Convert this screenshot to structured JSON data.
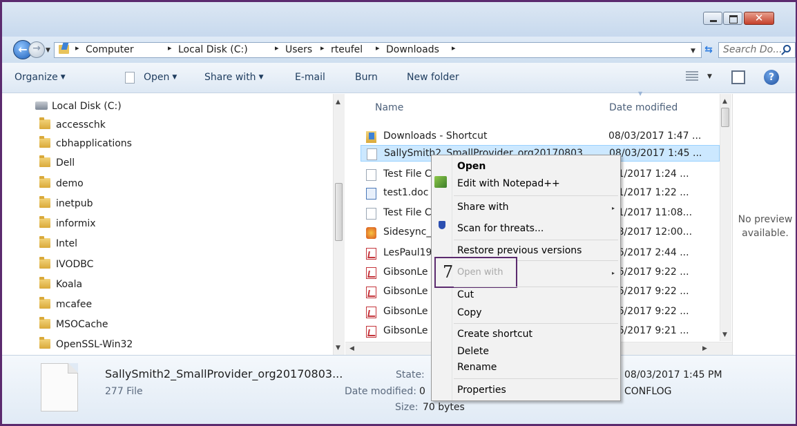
{
  "titlebar": {
    "close_glyph": "✕"
  },
  "address": {
    "crumbs": [
      "Computer",
      "Local Disk (C:)",
      "Users",
      "rteufel",
      "Downloads"
    ],
    "arrow": "▸",
    "search_placeholder": "Search Do..."
  },
  "toolbar": {
    "organize": "Organize",
    "open": "Open",
    "share_with": "Share with",
    "email": "E-mail",
    "burn": "Burn",
    "new_folder": "New folder",
    "dropdown_arrow": "▼",
    "help": "?"
  },
  "navpane": {
    "root": "Local Disk (C:)",
    "folders": [
      "accesschk",
      "cbhapplications",
      "Dell",
      "demo",
      "inetpub",
      "informix",
      "Intel",
      "IVODBC",
      "Koala",
      "mcafee",
      "MSOCache",
      "OpenSSL-Win32"
    ]
  },
  "filelist": {
    "columns": {
      "name": "Name",
      "date_modified": "Date modified"
    },
    "rows": [
      {
        "icon": "shortcut-icon",
        "name": "Downloads - Shortcut",
        "date": "08/03/2017 1:47 ..."
      },
      {
        "icon": "text-file-icon",
        "name": "SallySmith2_SmallProvider_org20170803...",
        "date": "08/03/2017 1:45 ..."
      },
      {
        "icon": "text-file-icon",
        "name": "Test File C",
        "date": "/31/2017 1:24 ..."
      },
      {
        "icon": "word-doc-icon",
        "name": "test1.doc",
        "date": "/31/2017 1:22 ..."
      },
      {
        "icon": "text-file-icon",
        "name": "Test File C",
        "date": "/21/2017 11:08..."
      },
      {
        "icon": "app-icon",
        "name": "Sidesync_",
        "date": "/18/2017 12:00..."
      },
      {
        "icon": "pdf-icon",
        "name": "LesPaul19",
        "date": "/26/2017 2:44 ..."
      },
      {
        "icon": "pdf-icon",
        "name": "GibsonLe",
        "date": "/26/2017 9:22 ..."
      },
      {
        "icon": "pdf-icon",
        "name": "GibsonLe",
        "date": "/26/2017 9:22 ..."
      },
      {
        "icon": "pdf-icon",
        "name": "GibsonLe",
        "date": "/26/2017 9:22 ..."
      },
      {
        "icon": "pdf-icon",
        "name": "GibsonLe",
        "date": "/26/2017 9:21 ..."
      }
    ]
  },
  "preview": {
    "line1": "No preview",
    "line2": "available."
  },
  "details": {
    "filename": "SallySmith2_SmallProvider_org20170803...",
    "type": "277 File",
    "state_label": "State:",
    "date_modified_label": "Date modified:",
    "date_modified_partial": "0",
    "size_label": "Size:",
    "size_value": "70 bytes",
    "created_value": "08/03/2017 1:45 PM",
    "owner_value": "CONFLOG"
  },
  "context_menu": {
    "open": "Open",
    "edit_notepad": "Edit with Notepad++",
    "share_with": "Share with",
    "scan": "Scan for threats...",
    "restore": "Restore previous versions",
    "open_with": "Open with",
    "cut": "Cut",
    "copy": "Copy",
    "create_shortcut": "Create shortcut",
    "delete": "Delete",
    "rename": "Rename",
    "properties": "Properties",
    "submenu_arrow": "▸"
  },
  "callout": {
    "number": "7"
  }
}
